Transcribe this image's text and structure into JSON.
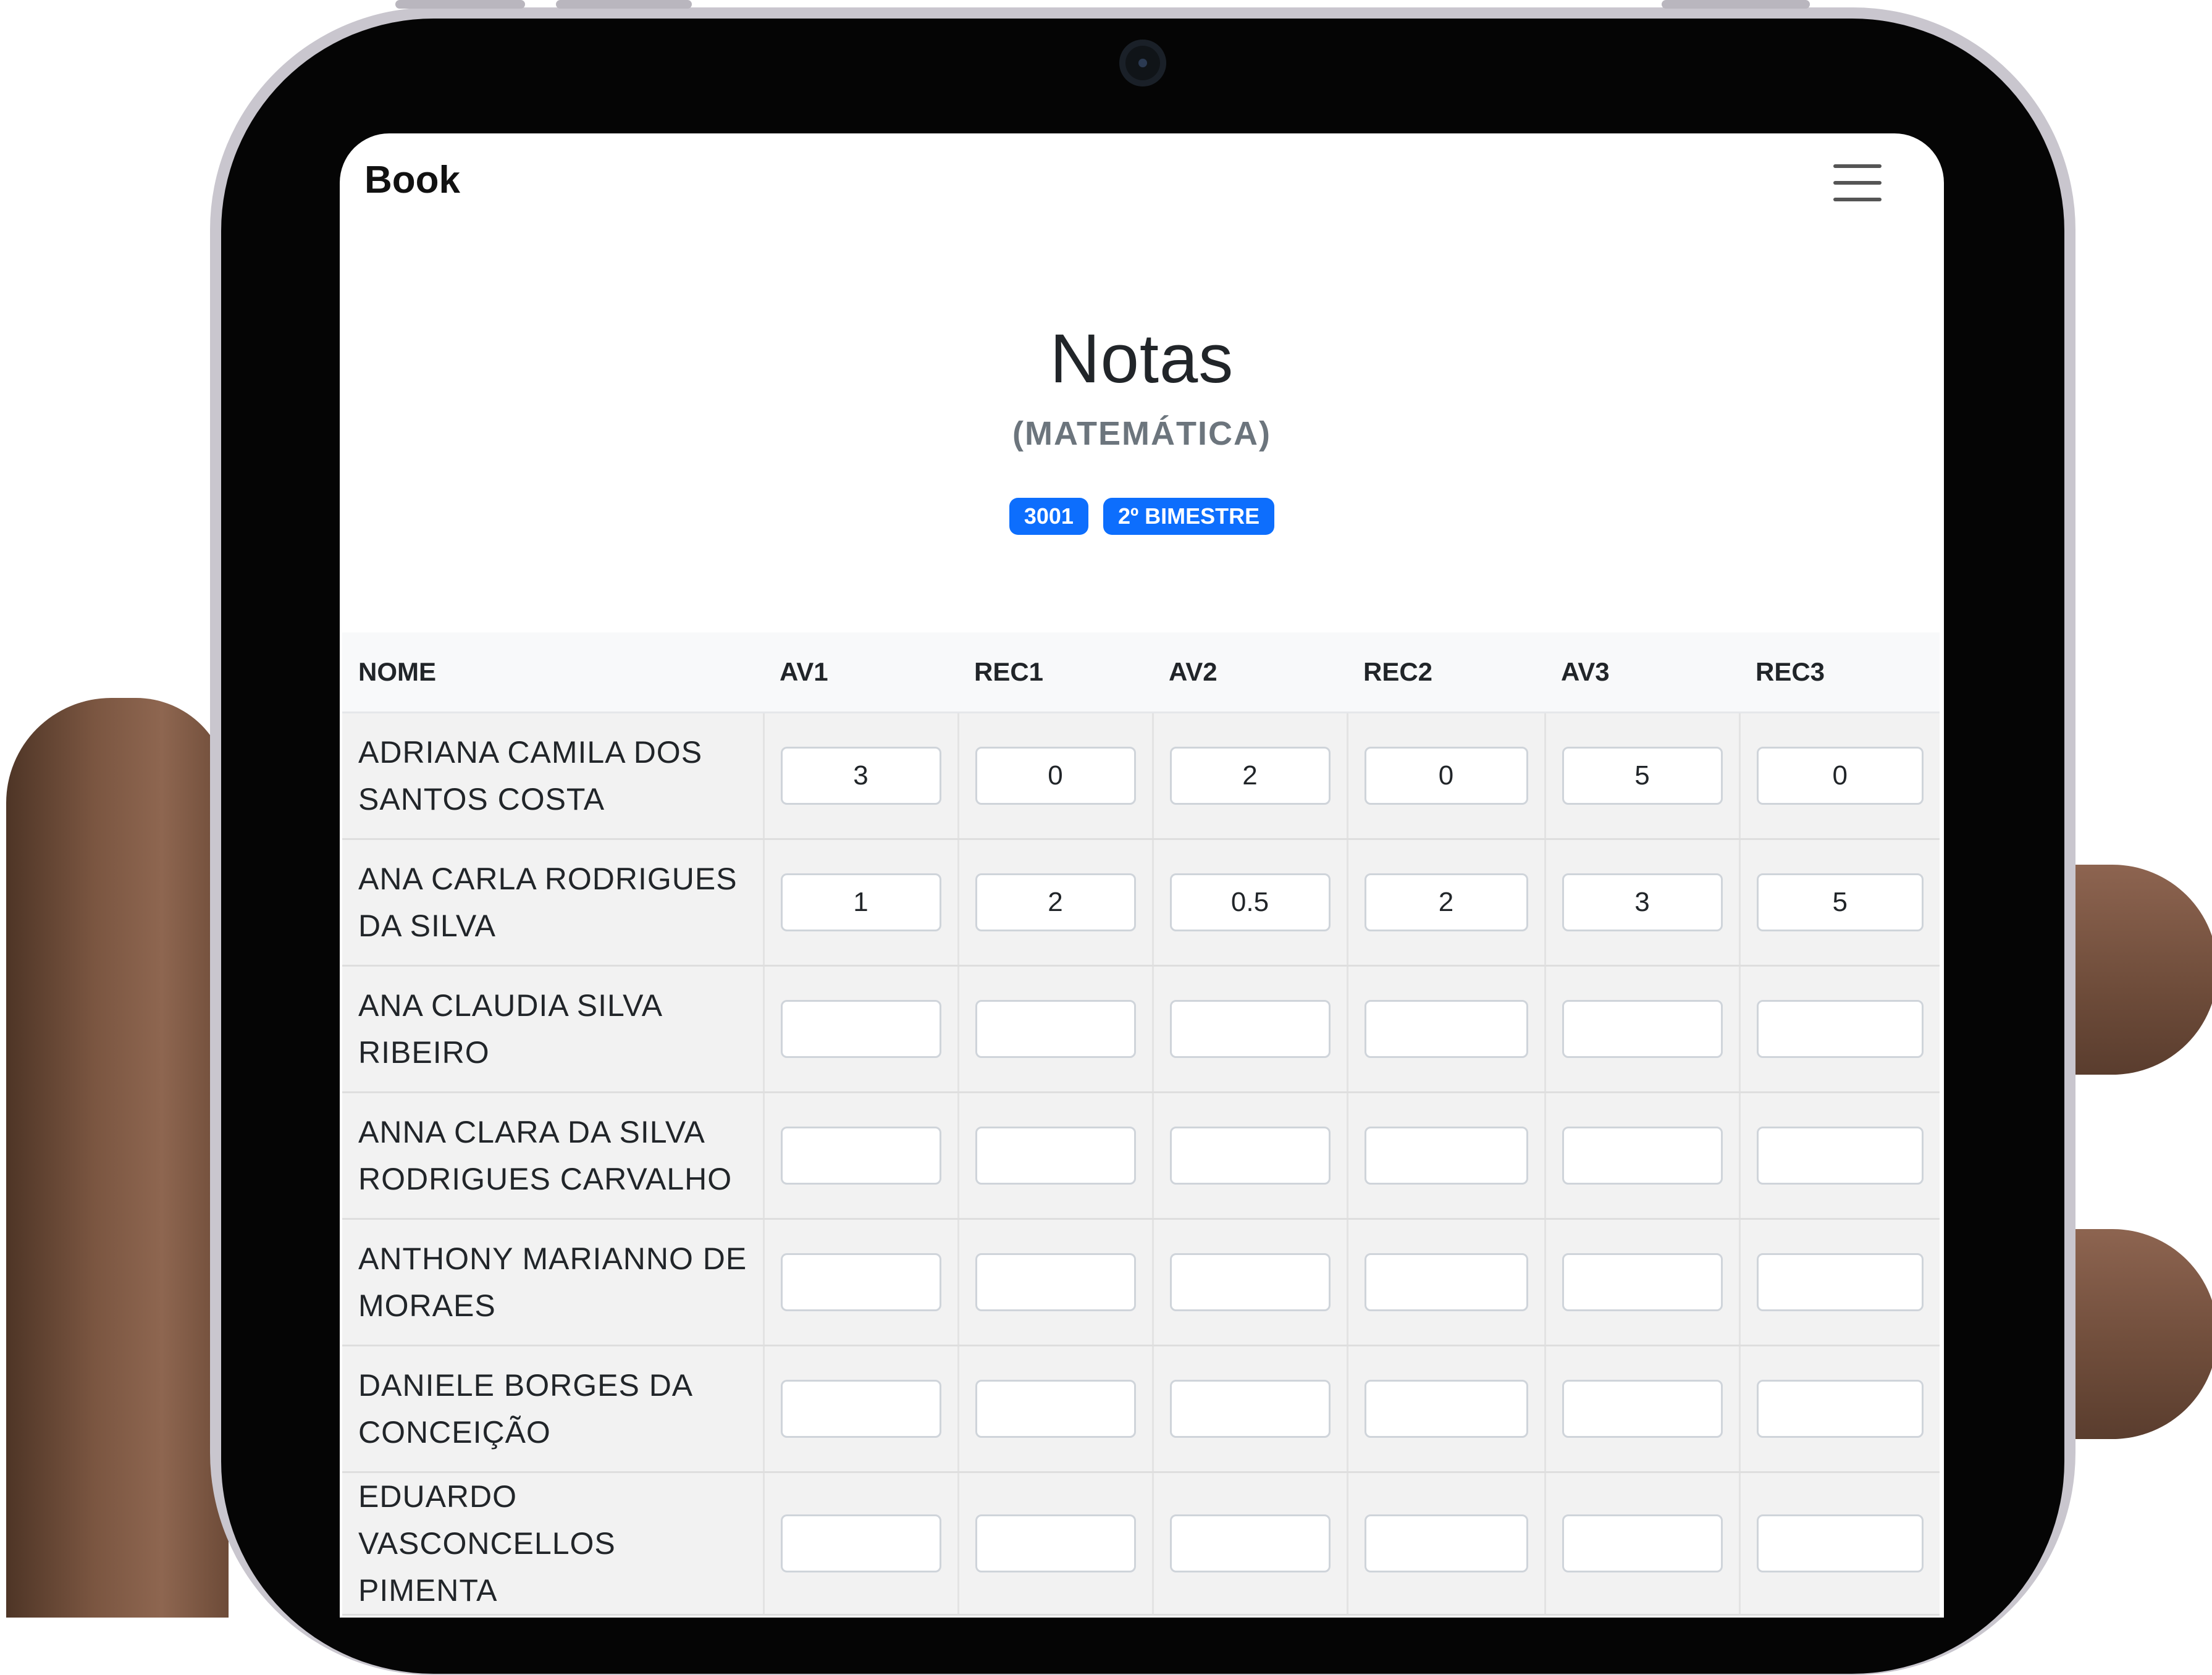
{
  "app": {
    "brand": "Book"
  },
  "page": {
    "title": "Notas",
    "subtitle": "(MATEMÁTICA)",
    "badges": [
      "3001",
      "2º BIMESTRE"
    ]
  },
  "colors": {
    "accent": "#0d6efd",
    "text": "#212529",
    "muted": "#6c757d",
    "row_bg": "#f2f2f2",
    "header_bg": "#f8f9fa"
  },
  "icons": {
    "menu": "hamburger-menu-icon"
  },
  "table": {
    "columns": [
      "NOME",
      "AV1",
      "REC1",
      "AV2",
      "REC2",
      "AV3",
      "REC3"
    ],
    "rows": [
      {
        "name": "ADRIANA CAMILA DOS SANTOS COSTA",
        "scores": [
          "3",
          "0",
          "2",
          "0",
          "5",
          "0"
        ]
      },
      {
        "name": "ANA CARLA RODRIGUES DA SILVA",
        "scores": [
          "1",
          "2",
          "0.5",
          "2",
          "3",
          "5"
        ]
      },
      {
        "name": "ANA CLAUDIA SILVA RIBEIRO",
        "scores": [
          "",
          "",
          "",
          "",
          "",
          ""
        ]
      },
      {
        "name": "ANNA CLARA DA SILVA RODRIGUES CARVALHO",
        "scores": [
          "",
          "",
          "",
          "",
          "",
          ""
        ]
      },
      {
        "name": "ANTHONY MARIANNO DE MORAES",
        "scores": [
          "",
          "",
          "",
          "",
          "",
          ""
        ]
      },
      {
        "name": "DANIELE BORGES DA CONCEIÇÃO",
        "scores": [
          "",
          "",
          "",
          "",
          "",
          ""
        ]
      },
      {
        "name": "EDUARDO VASCONCELLOS PIMENTA",
        "scores": [
          "",
          "",
          "",
          "",
          "",
          ""
        ]
      }
    ]
  }
}
